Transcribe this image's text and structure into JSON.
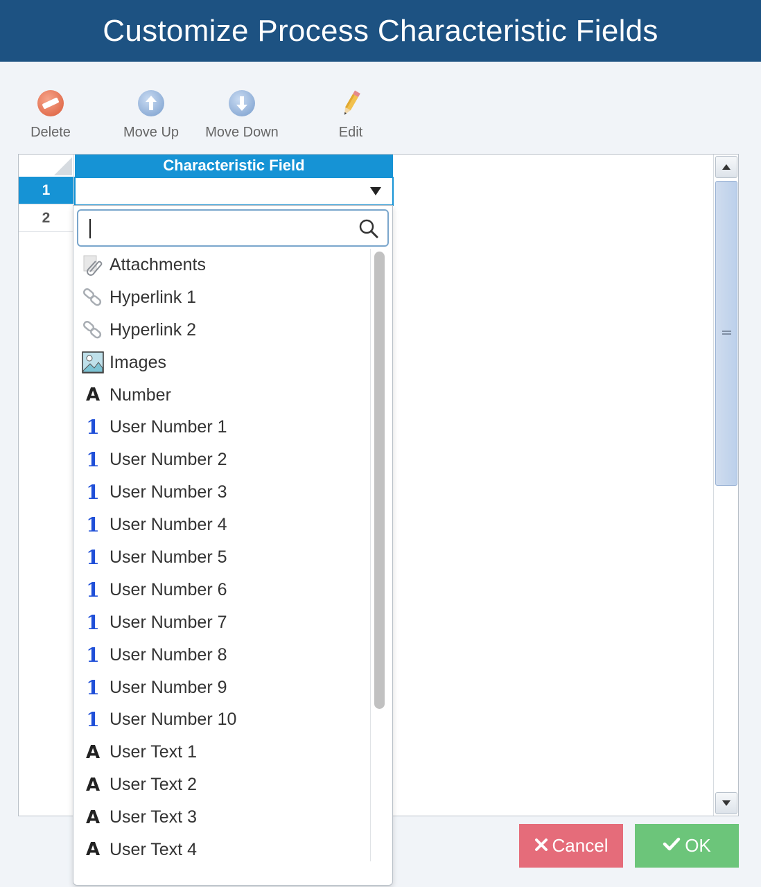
{
  "window": {
    "title": "Customize Process Characteristic Fields"
  },
  "toolbar": {
    "delete_label": "Delete",
    "move_up_label": "Move Up",
    "move_down_label": "Move Down",
    "edit_label": "Edit"
  },
  "grid": {
    "column_header": "Characteristic Field",
    "rows": [
      {
        "num": "1",
        "value": ""
      },
      {
        "num": "2",
        "value": ""
      }
    ]
  },
  "dropdown": {
    "search_value": "",
    "items": [
      {
        "icon": "attachment-icon",
        "label": "Attachments"
      },
      {
        "icon": "link-icon",
        "label": "Hyperlink 1"
      },
      {
        "icon": "link-icon",
        "label": "Hyperlink 2"
      },
      {
        "icon": "image-icon",
        "label": "Images"
      },
      {
        "icon": "text-a-icon",
        "label": "Number"
      },
      {
        "icon": "number-1-icon",
        "label": "User Number 1"
      },
      {
        "icon": "number-1-icon",
        "label": "User Number 2"
      },
      {
        "icon": "number-1-icon",
        "label": "User Number 3"
      },
      {
        "icon": "number-1-icon",
        "label": "User Number 4"
      },
      {
        "icon": "number-1-icon",
        "label": "User Number 5"
      },
      {
        "icon": "number-1-icon",
        "label": "User Number 6"
      },
      {
        "icon": "number-1-icon",
        "label": "User Number 7"
      },
      {
        "icon": "number-1-icon",
        "label": "User Number 8"
      },
      {
        "icon": "number-1-icon",
        "label": "User Number 9"
      },
      {
        "icon": "number-1-icon",
        "label": "User Number 10"
      },
      {
        "icon": "text-a-icon",
        "label": "User Text 1"
      },
      {
        "icon": "text-a-icon",
        "label": "User Text 2"
      },
      {
        "icon": "text-a-icon",
        "label": "User Text 3"
      },
      {
        "icon": "text-a-icon",
        "label": "User Text 4"
      }
    ]
  },
  "footer": {
    "cancel_label": "Cancel",
    "ok_label": "OK"
  },
  "colors": {
    "title_bar": "#1d5282",
    "header_blue": "#1693d5",
    "cancel": "#e56c7a",
    "ok": "#6cc57a"
  }
}
